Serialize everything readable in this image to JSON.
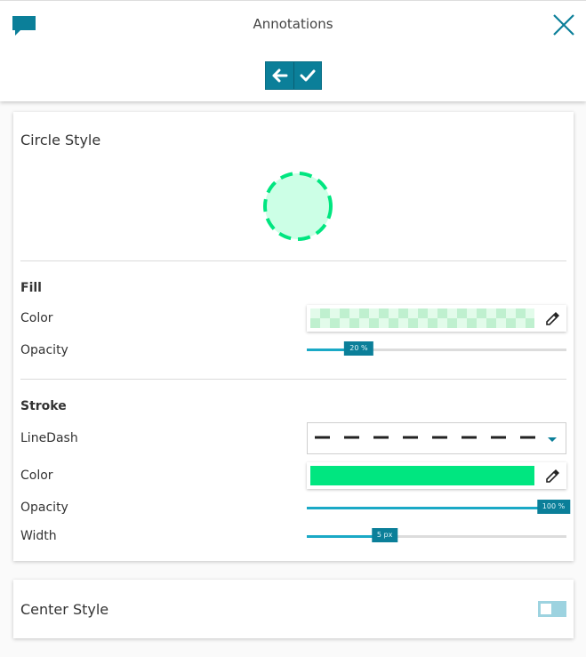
{
  "header": {
    "title": "Annotations",
    "icons": {
      "chat": "chat-bubble-icon",
      "close": "close-icon",
      "back": "arrow-left-icon",
      "confirm": "checkmark-icon"
    }
  },
  "circle_style": {
    "title": "Circle Style",
    "fill": {
      "title": "Fill",
      "color_label": "Color",
      "color_value": "#00e680",
      "opacity_label": "Opacity",
      "opacity_value": "20 %",
      "opacity_fraction": 0.2
    },
    "stroke": {
      "title": "Stroke",
      "linedash_label": "LineDash",
      "color_label": "Color",
      "color_value": "#00e680",
      "opacity_label": "Opacity",
      "opacity_value": "100 %",
      "opacity_fraction": 1.0,
      "width_label": "Width",
      "width_value": "5 px",
      "width_fraction": 0.3
    }
  },
  "center_style": {
    "title": "Center Style",
    "enabled": false
  },
  "colors": {
    "accent": "#0b7f99",
    "stroke_green": "#00e680",
    "fill_green_light": "#ccffe6"
  }
}
